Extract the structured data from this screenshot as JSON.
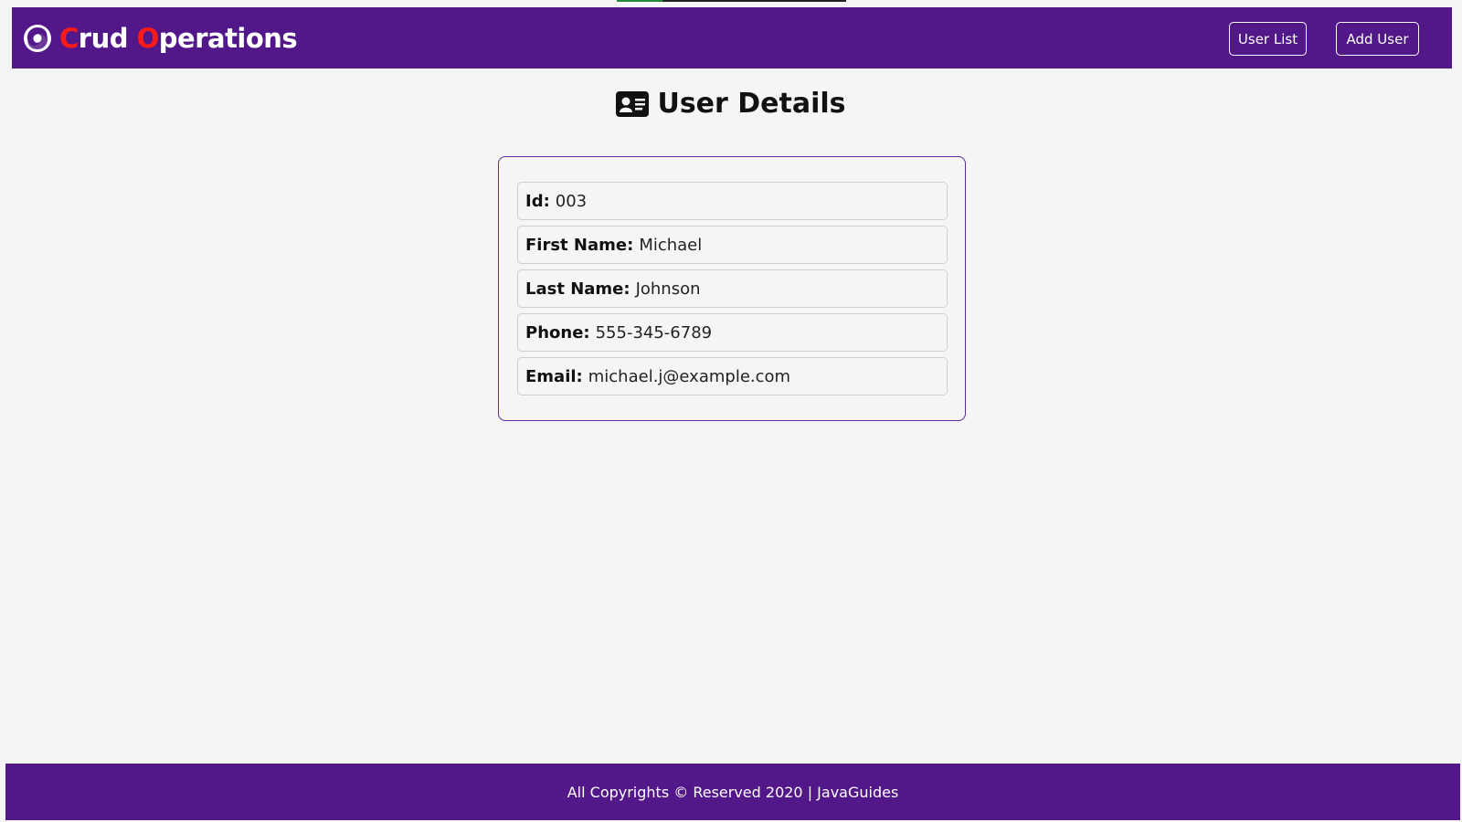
{
  "navbar": {
    "brand_first_letter_1": "C",
    "brand_rest_1": "rud ",
    "brand_first_letter_2": "O",
    "brand_rest_2": "perations",
    "buttons": {
      "user_list": "User List",
      "add_user": "Add User"
    },
    "logo_icon": "swirl-logo-icon"
  },
  "page": {
    "title": "User Details",
    "title_icon": "id-card-icon"
  },
  "details": [
    {
      "label": "Id:",
      "value": "003"
    },
    {
      "label": "First Name:",
      "value": "Michael"
    },
    {
      "label": "Last Name:",
      "value": "Johnson"
    },
    {
      "label": "Phone:",
      "value": "555-345-6789"
    },
    {
      "label": "Email:",
      "value": "michael.j@example.com"
    }
  ],
  "footer": {
    "text": "All Copyrights © Reserved 2020 | JavaGuides"
  },
  "colors": {
    "primary": "#521788",
    "brand_accent": "#ff1a1a",
    "background": "#f5f5f5"
  }
}
